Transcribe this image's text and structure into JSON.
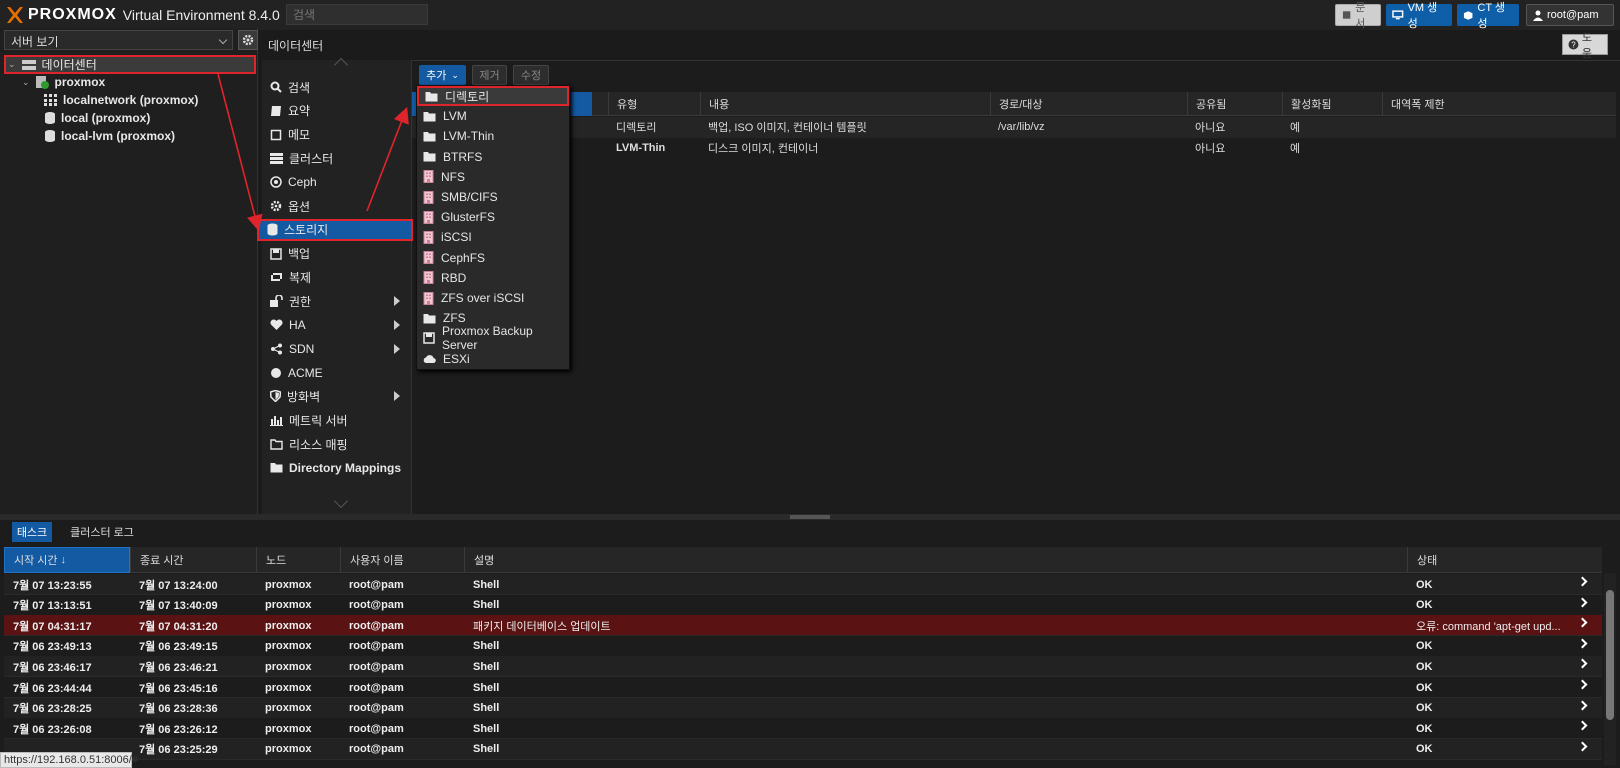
{
  "header": {
    "brand": "PROXMOX",
    "version": "Virtual Environment 8.4.0",
    "search_placeholder": "검색",
    "docs_label": "문서",
    "create_vm_label": "VM 생성",
    "create_ct_label": "CT 생성",
    "user_label": "root@pam"
  },
  "tree": {
    "view_label": "서버 보기",
    "datacenter": "데이터센터",
    "node": "proxmox",
    "items": [
      "localnetwork (proxmox)",
      "local (proxmox)",
      "local-lvm (proxmox)"
    ]
  },
  "content": {
    "title": "데이터센터",
    "help_label": "도움"
  },
  "menu": {
    "items": [
      {
        "label": "검색",
        "icon": "search-icon"
      },
      {
        "label": "요약",
        "icon": "book-icon"
      },
      {
        "label": "메모",
        "icon": "note-icon"
      },
      {
        "label": "클러스터",
        "icon": "server-icon"
      },
      {
        "label": "Ceph",
        "icon": "ceph-icon"
      },
      {
        "label": "옵션",
        "icon": "gear-icon"
      },
      {
        "label": "스토리지",
        "icon": "database-icon"
      },
      {
        "label": "백업",
        "icon": "floppy-icon"
      },
      {
        "label": "복제",
        "icon": "retweet-icon"
      },
      {
        "label": "권한",
        "icon": "unlock-icon"
      },
      {
        "label": "HA",
        "icon": "heartbeat-icon"
      },
      {
        "label": "SDN",
        "icon": "sdn-icon"
      },
      {
        "label": "ACME",
        "icon": "certificate-icon"
      },
      {
        "label": "방화벽",
        "icon": "shield-icon"
      },
      {
        "label": "메트릭 서버",
        "icon": "bar-chart-icon"
      },
      {
        "label": "리소스 매핑",
        "icon": "folder-outline-icon"
      },
      {
        "label": "Directory Mappings",
        "icon": "folder-icon"
      }
    ]
  },
  "toolbar": {
    "add_label": "추가",
    "remove_label": "제거",
    "edit_label": "수정"
  },
  "storage_grid": {
    "columns": [
      "유형",
      "내용",
      "경로/대상",
      "공유됨",
      "활성화됨",
      "대역폭 제한"
    ],
    "rows": [
      {
        "type": "디렉토리",
        "content": "백업, ISO 이미지, 컨테이너 템플릿",
        "path": "/var/lib/vz",
        "shared": "아니요",
        "enabled": "예"
      },
      {
        "type": "LVM-Thin",
        "content": "디스크 이미지, 컨테이너",
        "path": "",
        "shared": "아니요",
        "enabled": "예"
      }
    ]
  },
  "add_dropdown": {
    "items": [
      {
        "label": "디렉토리",
        "icon": "folder-icon"
      },
      {
        "label": "LVM",
        "icon": "folder-icon"
      },
      {
        "label": "LVM-Thin",
        "icon": "folder-icon"
      },
      {
        "label": "BTRFS",
        "icon": "folder-icon"
      },
      {
        "label": "NFS",
        "icon": "building-icon"
      },
      {
        "label": "SMB/CIFS",
        "icon": "building-icon"
      },
      {
        "label": "GlusterFS",
        "icon": "building-icon"
      },
      {
        "label": "iSCSI",
        "icon": "building-icon"
      },
      {
        "label": "CephFS",
        "icon": "building-icon"
      },
      {
        "label": "RBD",
        "icon": "building-icon"
      },
      {
        "label": "ZFS over iSCSI",
        "icon": "building-icon"
      },
      {
        "label": "ZFS",
        "icon": "folder-icon"
      },
      {
        "label": "Proxmox Backup Server",
        "icon": "floppy-icon"
      },
      {
        "label": "ESXi",
        "icon": "cloud-icon"
      }
    ]
  },
  "bottom": {
    "tabs": [
      "태스크",
      "클러스터 로그"
    ],
    "columns": [
      "시작 시간",
      "종료 시간",
      "노드",
      "사용자 이름",
      "설명",
      "상태"
    ],
    "rows": [
      {
        "start": "7월 07 13:23:55",
        "end": "7월 07 13:24:00",
        "node": "proxmox",
        "user": "root@pam",
        "desc": "Shell",
        "status": "OK"
      },
      {
        "start": "7월 07 13:13:51",
        "end": "7월 07 13:40:09",
        "node": "proxmox",
        "user": "root@pam",
        "desc": "Shell",
        "status": "OK"
      },
      {
        "start": "7월 07 04:31:17",
        "end": "7월 07 04:31:20",
        "node": "proxmox",
        "user": "root@pam",
        "desc": "패키지 데이터베이스 업데이트",
        "status": "오류: command 'apt-get upd..."
      },
      {
        "start": "7월 06 23:49:13",
        "end": "7월 06 23:49:15",
        "node": "proxmox",
        "user": "root@pam",
        "desc": "Shell",
        "status": "OK"
      },
      {
        "start": "7월 06 23:46:17",
        "end": "7월 06 23:46:21",
        "node": "proxmox",
        "user": "root@pam",
        "desc": "Shell",
        "status": "OK"
      },
      {
        "start": "7월 06 23:44:44",
        "end": "7월 06 23:45:16",
        "node": "proxmox",
        "user": "root@pam",
        "desc": "Shell",
        "status": "OK"
      },
      {
        "start": "7월 06 23:28:25",
        "end": "7월 06 23:28:36",
        "node": "proxmox",
        "user": "root@pam",
        "desc": "Shell",
        "status": "OK"
      },
      {
        "start": "7월 06 23:26:08",
        "end": "7월 06 23:26:12",
        "node": "proxmox",
        "user": "root@pam",
        "desc": "Shell",
        "status": "OK"
      },
      {
        "start": "",
        "end": "7월 06 23:25:29",
        "node": "proxmox",
        "user": "root@pam",
        "desc": "Shell",
        "status": "OK"
      }
    ]
  },
  "status_url": "https://192.168.0.51:8006/#",
  "colors": {
    "accent": "#145aa2",
    "highlight": "#e0242b",
    "error_row": "#5a1212"
  }
}
